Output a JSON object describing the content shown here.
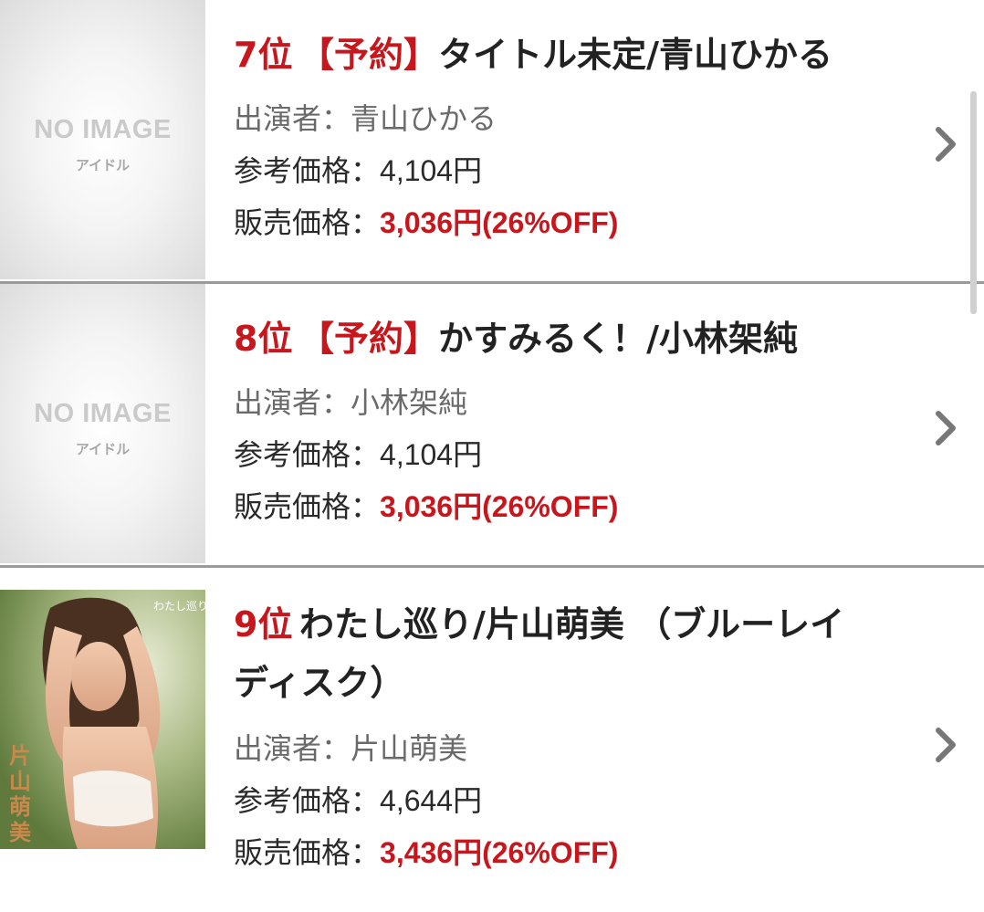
{
  "items": [
    {
      "rank": "7位",
      "tag": "【予約】",
      "title": "タイトル未定/青山ひかる",
      "thumb_text": "NO IMAGE",
      "thumb_sub": "アイドル",
      "performer_label": "出演者：",
      "performer": "青山ひかる",
      "ref_label": "参考価格：",
      "ref_price": "4,104円",
      "sale_label": "販売価格：",
      "sale_price": "3,036円(26%OFF)"
    },
    {
      "rank": "8位",
      "tag": "【予約】",
      "title": "かすみるく！/小林架純",
      "thumb_text": "NO IMAGE",
      "thumb_sub": "アイドル",
      "performer_label": "出演者：",
      "performer": "小林架純",
      "ref_label": "参考価格：",
      "ref_price": "4,104円",
      "sale_label": "販売価格：",
      "sale_price": "3,036円(26%OFF)"
    },
    {
      "rank": "9位",
      "title_line1": "わたし巡り/片山萌美 （ブルーレイ",
      "title_line2": "ディスク）",
      "cover_text": "片山萌美",
      "cover_subtitle": "わたし巡り",
      "performer_label": "出演者：",
      "performer": "片山萌美",
      "ref_label": "参考価格：",
      "ref_price": "4,644円",
      "sale_label": "販売価格：",
      "sale_price": "3,436円(26%OFF)"
    }
  ],
  "colors": {
    "accent_red": "#c8161d",
    "text_dark": "#222222",
    "text_gray": "#6a6a6a",
    "divider": "#9a9a9a"
  },
  "icons": {
    "row_arrow": "chevron-right-icon"
  }
}
